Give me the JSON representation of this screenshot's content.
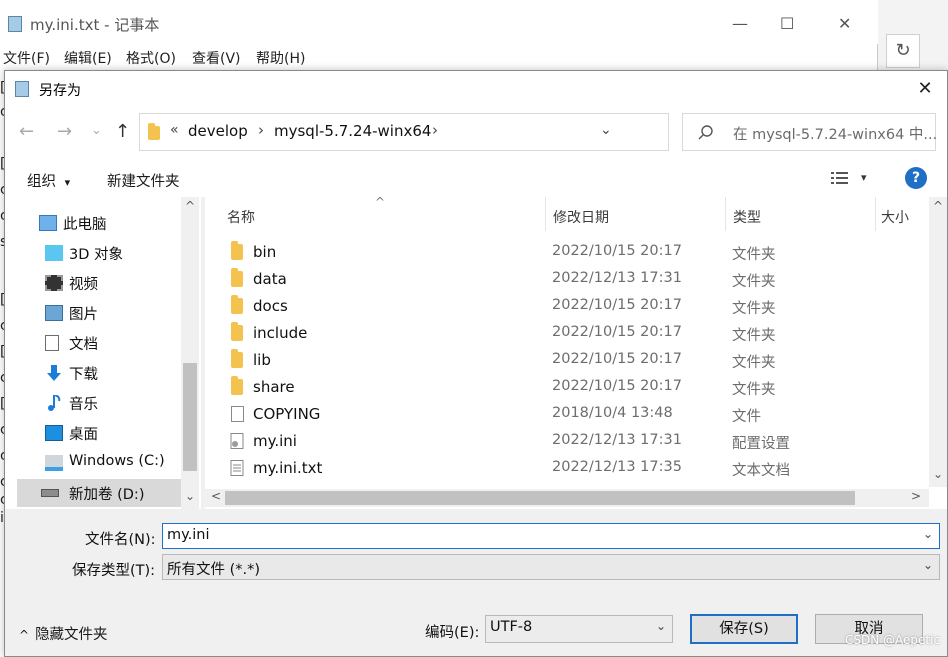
{
  "notepad": {
    "title": "my.ini.txt - 记事本",
    "menu": [
      "文件(F)",
      "编辑(E)",
      "格式(O)",
      "查看(V)",
      "帮助(H)"
    ],
    "minimize": "—",
    "maximize": "☐",
    "close": "✕",
    "visible_chars": [
      "[",
      "c",
      "[",
      "c",
      "c",
      "s",
      "[",
      "c",
      "[",
      "c",
      "[",
      "c",
      "c",
      "c",
      "c",
      "i"
    ]
  },
  "background": {
    "refresh_icon": "↻"
  },
  "dialog": {
    "title": "另存为",
    "close": "✕",
    "nav": {
      "back": "←",
      "forward": "→",
      "recent": "⌄",
      "up": "↑",
      "breadcrumb_prefix": "«",
      "breadcrumb": [
        "develop",
        "mysql-5.7.24-winx64"
      ],
      "separator": "›",
      "dropdown": "⌄",
      "refresh": "↻",
      "search_placeholder": "在 mysql-5.7.24-winx64 中..."
    },
    "toolbar": {
      "organize": "组织",
      "organize_caret": "▾",
      "new_folder": "新建文件夹",
      "view_caret": "▾",
      "help": "?"
    },
    "navpane": {
      "items": [
        {
          "label": "此电脑"
        },
        {
          "label": "3D 对象"
        },
        {
          "label": "视频"
        },
        {
          "label": "图片"
        },
        {
          "label": "文档"
        },
        {
          "label": "下载"
        },
        {
          "label": "音乐"
        },
        {
          "label": "桌面"
        },
        {
          "label": "Windows (C:)"
        },
        {
          "label": "新加卷 (D:)"
        }
      ]
    },
    "filelist": {
      "columns": [
        "名称",
        "修改日期",
        "类型",
        "大小"
      ],
      "sort_indicator": "^",
      "rows": [
        {
          "name": "bin",
          "date": "2022/10/15 20:17",
          "type": "文件夹",
          "kind": "folder"
        },
        {
          "name": "data",
          "date": "2022/12/13 17:31",
          "type": "文件夹",
          "kind": "folder"
        },
        {
          "name": "docs",
          "date": "2022/10/15 20:17",
          "type": "文件夹",
          "kind": "folder"
        },
        {
          "name": "include",
          "date": "2022/10/15 20:17",
          "type": "文件夹",
          "kind": "folder"
        },
        {
          "name": "lib",
          "date": "2022/10/15 20:17",
          "type": "文件夹",
          "kind": "folder"
        },
        {
          "name": "share",
          "date": "2022/10/15 20:17",
          "type": "文件夹",
          "kind": "folder"
        },
        {
          "name": "COPYING",
          "date": "2018/10/4 13:48",
          "type": "文件",
          "kind": "file"
        },
        {
          "name": "my.ini",
          "date": "2022/12/13 17:31",
          "type": "配置设置",
          "kind": "config"
        },
        {
          "name": "my.ini.txt",
          "date": "2022/12/13 17:35",
          "type": "文本文档",
          "kind": "text"
        }
      ],
      "scroll_up": "^",
      "scroll_down": "⌄",
      "scroll_left": "<",
      "scroll_right": ">"
    },
    "form": {
      "filename_label": "文件名(N):",
      "filename_value": "my.ini",
      "filetype_label": "保存类型(T):",
      "filetype_value": "所有文件  (*.*)",
      "hide_folders": "隐藏文件夹",
      "encoding_label": "编码(E):",
      "encoding_value": "UTF-8",
      "save": "保存(S)",
      "cancel": "取消"
    },
    "watermark": "CSDN @Aepetic"
  }
}
